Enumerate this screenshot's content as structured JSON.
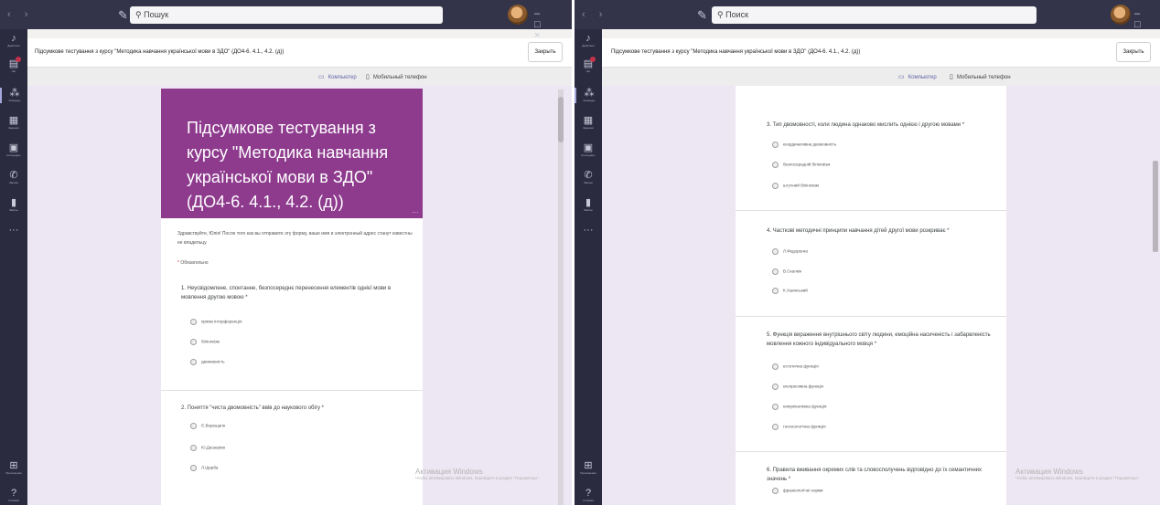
{
  "app": {
    "search_left": "Пошук",
    "search_right": "Поиск",
    "nav_arrows": "‹ ›",
    "compose_glyph": "✎",
    "win_controls_left": "– □ ×",
    "win_controls_right": "– □"
  },
  "rail": {
    "items": [
      {
        "icon": "bell-icon",
        "glyph": "♪",
        "label": "Действия"
      },
      {
        "icon": "chat-icon",
        "glyph": "▤",
        "label": "Чат"
      },
      {
        "icon": "teams-icon",
        "glyph": "⁂",
        "label": "Команды"
      },
      {
        "icon": "assignments-icon",
        "glyph": "▦",
        "label": "Задания"
      },
      {
        "icon": "calendar-icon",
        "glyph": "▣",
        "label": "Календарь"
      },
      {
        "icon": "calls-icon",
        "glyph": "✆",
        "label": "Звонки"
      },
      {
        "icon": "files-icon",
        "glyph": "▮",
        "label": "Файлы"
      },
      {
        "icon": "more-icon",
        "glyph": "···",
        "label": ""
      }
    ],
    "apps": {
      "icon": "apps-icon",
      "glyph": "⊞",
      "label": "Приложения"
    },
    "help": {
      "icon": "help-icon",
      "glyph": "?",
      "label": "Справка"
    }
  },
  "header": {
    "title_left": "Підсумкове тестування з курсу \"Методика навчання української мови в ЗДО\" (ДО4-6. 4.1., 4.2. (д))",
    "title_right": "Підсумкове тестування з курсу \"Методика навчання української мови в ЗДО\" (ДО4-6. 4.1., 4.2. (д))",
    "close_label": "Закрыть"
  },
  "viewbar": {
    "desktop_label": "Компьютер",
    "mobile_label": "Мобильный телефон"
  },
  "form_left": {
    "banner_title": "Підсумкове тестування з курсу \"Методика навчання української мови в ЗДО\" (ДО4-6. 4.1., 4.2. (д))",
    "banner_more": "···",
    "intro": "Здравствуйте, Юлія! После того как вы отправите эту форму, ваше имя и электронный адрес станут известны ее владельцу.",
    "required_star": "*",
    "required_label": "Обязательно",
    "questions": [
      {
        "text": "1. Неусвідомлене, спонтанне, безпосереднє перенесення елементів однієї мови в мовлення другою мовою *",
        "options": [
          "пряма інтерференція",
          "білінгвізм",
          "двомовність"
        ]
      },
      {
        "text": "2. Поняття \"чиста двомовність\" ввів до наукового обігу *",
        "options": [
          "Є.Верещагін",
          "Ю.Дешеріев",
          "Л.Щерба"
        ]
      }
    ]
  },
  "form_right": {
    "questions": [
      {
        "text": "3. Тип двомовності, коли людина однаково мислить однією і другою мовами *",
        "options": [
          "координативна двомовність",
          "безпосередній білінгвізм",
          "штучний білінгвізм"
        ]
      },
      {
        "text": "4. Часткові методичні принципи навчання дітей другої мови розкриває *",
        "options": [
          "Л.Федоренко",
          "В.Скалкін",
          "К.Ушинський"
        ]
      },
      {
        "text": "5. Функція вираження внутрішнього світу людини, емоційна насиченість і забарвленість мовлення кожного індивідуального мовця *",
        "options": [
          "естетична функція",
          "експресивна функція",
          "комунікативна функція",
          "гносеологічна функція"
        ]
      },
      {
        "text": "6. Правила вживання окремих слів та словосполучень відповідно до їх семантичних значень *",
        "options": [
          "фразеологічні норми"
        ]
      }
    ]
  },
  "watermark": {
    "title": "Активация Windows",
    "subtitle": "Чтобы активировать Windows, перейдите в раздел \"Параметры\"."
  }
}
